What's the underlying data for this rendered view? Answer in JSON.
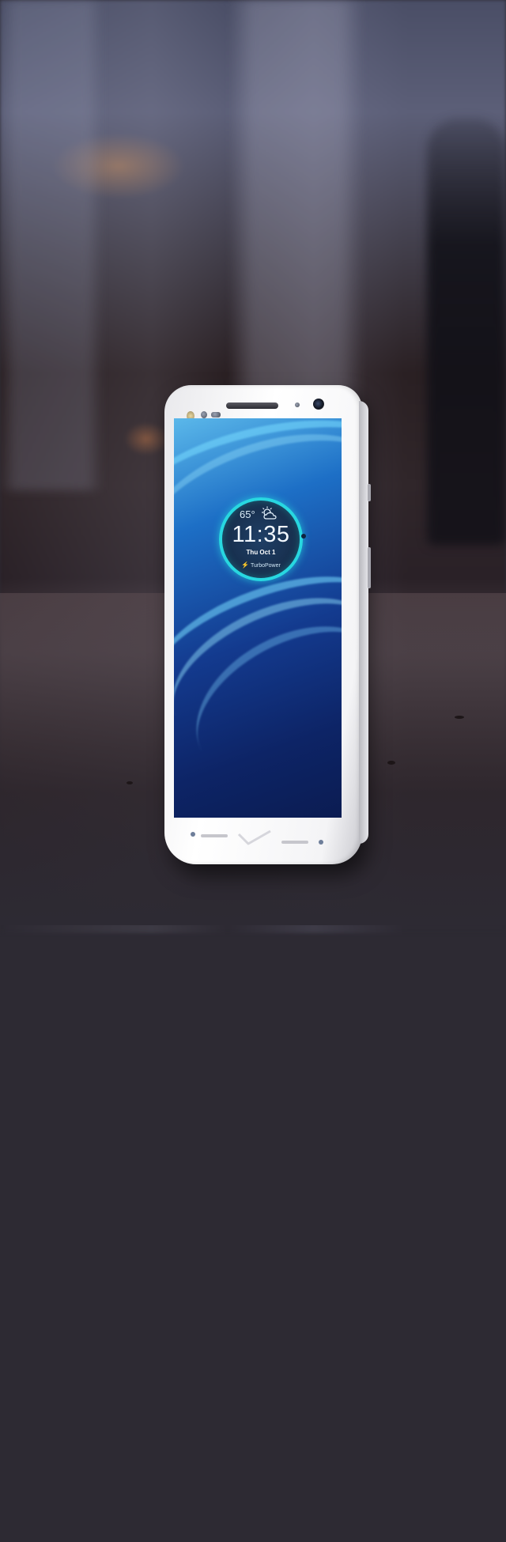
{
  "scene": {
    "background_color": "#2d2a33",
    "accent_color": "#28d7e0"
  },
  "phone": {
    "body_color": "#ffffff",
    "screen": {
      "clock_widget": {
        "temperature": "65°",
        "weather_icon": "partly-sunny-icon",
        "time": "11:35",
        "date": "Thu Oct 1",
        "power_label": "TurboPower",
        "power_icon": "lightning-bolt-icon"
      }
    }
  }
}
